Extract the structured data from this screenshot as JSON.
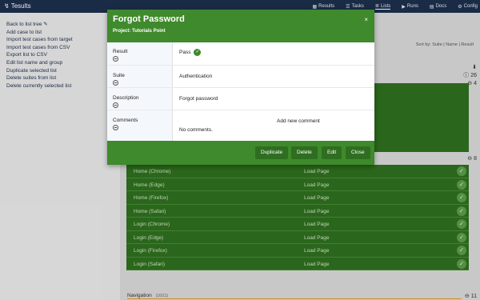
{
  "topbar": {
    "brand": "Tesults",
    "nav": [
      {
        "label": "Results",
        "icon": "chart-icon",
        "glyph": "▦"
      },
      {
        "label": "Tasks",
        "icon": "tasks-icon",
        "glyph": "☰"
      },
      {
        "label": "Lists",
        "icon": "list-icon",
        "glyph": "≣"
      },
      {
        "label": "Runs",
        "icon": "runs-icon",
        "glyph": "▶"
      },
      {
        "label": "Docs",
        "icon": "docs-icon",
        "glyph": "▤"
      },
      {
        "label": "Config",
        "icon": "gear-icon",
        "glyph": "⚙"
      }
    ]
  },
  "sidebar": {
    "items": [
      "Back to list tree ✎",
      "Add case to list",
      "Import test cases from target",
      "Import test cases from CSV",
      "Export list to CSV",
      "Edit list name and group",
      "Duplicate selected list",
      "Delete suites from list",
      "Delete currently selected list"
    ]
  },
  "main": {
    "sort": "Sort by: Suite | Name | Result",
    "count_top": "26",
    "count_top2": "4",
    "count_mid": "8",
    "group3_name": "Navigation",
    "group3_sub": "(16/11)",
    "count_bottom": "11",
    "rows": [
      {
        "name": "Home (Chrome)",
        "desc": "Load Page"
      },
      {
        "name": "Home (Edge)",
        "desc": "Load Page"
      },
      {
        "name": "Home (Firefox)",
        "desc": "Load Page"
      },
      {
        "name": "Home (Safari)",
        "desc": "Load Page"
      },
      {
        "name": "Login (Chrome)",
        "desc": "Load Page"
      },
      {
        "name": "Login (Edge)",
        "desc": "Load Page"
      },
      {
        "name": "Login (Firefox)",
        "desc": "Load Page"
      },
      {
        "name": "Login (Safari)",
        "desc": "Load Page"
      }
    ]
  },
  "modal": {
    "title": "Forgot Password",
    "project": "Project: Tutorials Point",
    "close": "×",
    "fields": {
      "result_label": "Result",
      "result_value": "Pass",
      "suite_label": "Suite",
      "suite_value": "Authentication",
      "description_label": "Description",
      "description_value": "Forgot password",
      "comments_label": "Comments",
      "comments_value": "No comments.",
      "add_comment": "Add new comment"
    },
    "buttons": {
      "duplicate": "Duplicate",
      "delete": "Delete",
      "edit": "Edit",
      "close": "Close"
    }
  }
}
